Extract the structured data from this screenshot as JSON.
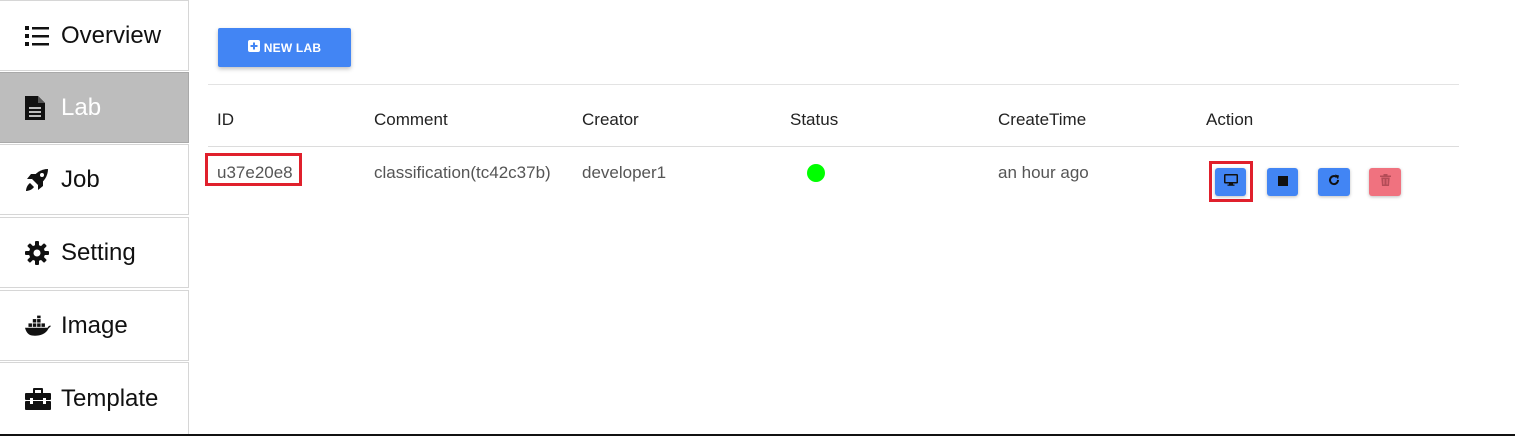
{
  "sidebar": {
    "items": [
      {
        "label": "Overview",
        "icon": "list-icon",
        "active": false
      },
      {
        "label": "Lab",
        "icon": "document-icon",
        "active": true
      },
      {
        "label": "Job",
        "icon": "rocket-icon",
        "active": false
      },
      {
        "label": "Setting",
        "icon": "gear-icon",
        "active": false
      },
      {
        "label": "Image",
        "icon": "docker-whale-icon",
        "active": false
      },
      {
        "label": "Template",
        "icon": "toolbox-icon",
        "active": false
      }
    ]
  },
  "toolbar": {
    "new_lab_label": "NEW LAB"
  },
  "table": {
    "headers": [
      "ID",
      "Comment",
      "Creator",
      "Status",
      "CreateTime",
      "Action"
    ],
    "rows": [
      {
        "id": "u37e20e8",
        "comment": "classification(tc42c37b)",
        "creator": "developer1",
        "status": "running",
        "create_time": "an hour ago",
        "actions": [
          "desktop-icon",
          "stop-icon",
          "restart-icon",
          "delete-icon"
        ]
      }
    ]
  },
  "colors": {
    "primary": "#4285f4",
    "danger": "#f0727f",
    "status_running": "#00ff00",
    "highlight": "#e0202c",
    "sidebar_active": "#bdbdbd"
  }
}
